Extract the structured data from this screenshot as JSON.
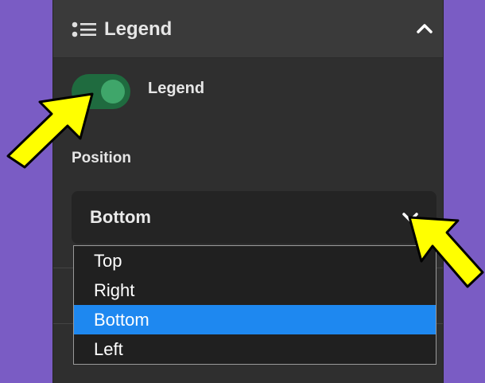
{
  "panel": {
    "title": "Legend",
    "header_icon": "legend-list-icon",
    "collapse_icon": "chevron-up-icon"
  },
  "legend_toggle": {
    "label": "Legend",
    "on": true,
    "color": "#1f6b3f"
  },
  "position_field": {
    "label": "Position",
    "selected": "Bottom",
    "dropdown_icon": "chevron-down-icon",
    "options": [
      "Top",
      "Right",
      "Bottom",
      "Left"
    ],
    "highlight_color": "#1e88f0"
  },
  "annotations": {
    "arrow_color": "#ffff00"
  }
}
